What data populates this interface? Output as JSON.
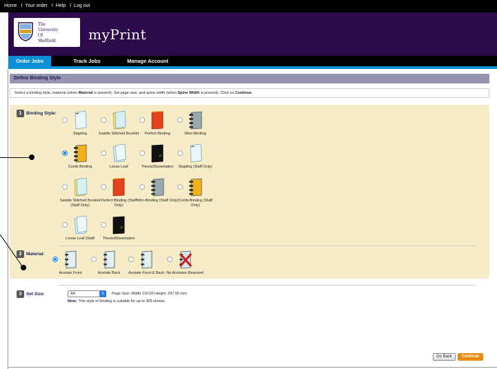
{
  "topbar": {
    "links": [
      "Home",
      "Your order",
      "Help",
      "Log out"
    ],
    "separator": "I"
  },
  "header": {
    "university": [
      "The",
      "University",
      "Of",
      "Sheffield."
    ],
    "app_title": "myPrint"
  },
  "nav": {
    "tabs": [
      "Order Jobs",
      "Track Jobs",
      "Manage Account"
    ],
    "active": "Order Jobs"
  },
  "page": {
    "section_title": "Define Binding Style",
    "instruction_parts": [
      "Select a binding style, material (when ",
      "Material",
      " is present), Set page size, and spine width (when ",
      "Spine Width",
      " is present). Click on ",
      "Continue",
      "."
    ]
  },
  "steps": {
    "binding": {
      "num": "1",
      "label": "Binding Style:"
    },
    "material": {
      "num": "2",
      "label": "Material:"
    },
    "size": {
      "num": "3",
      "label": "Set Size:"
    }
  },
  "binding_options": [
    {
      "label": "Stapling",
      "icon": "stapling-icon",
      "selected": false
    },
    {
      "label": "Saddle Stitched Booklet",
      "icon": "booklet-icon",
      "selected": false
    },
    {
      "label": "Perfect Binding",
      "icon": "perfect-binding-icon",
      "selected": false
    },
    {
      "label": "Wiro-Binding",
      "icon": "wiro-binding-icon",
      "selected": false
    },
    {
      "label": "Comb-Binding",
      "icon": "comb-binding-icon",
      "selected": true
    },
    {
      "label": "Loose Leaf",
      "icon": "loose-leaf-icon",
      "selected": false
    },
    {
      "label": "Thesis/Dissertation",
      "icon": "thesis-icon",
      "selected": false
    },
    {
      "label": "Stapling (Staff Only)",
      "icon": "stapling-icon",
      "selected": false
    },
    {
      "label": "Saddle Stitched Booklet (Staff Only)",
      "icon": "booklet-icon",
      "selected": false
    },
    {
      "label": "Perfect Binding (Staff Only)",
      "icon": "perfect-binding-icon",
      "selected": false
    },
    {
      "label": "Wiro-Binding (Staff Only)",
      "icon": "wiro-binding-icon",
      "selected": false
    },
    {
      "label": "Comb-Binding (Staff Only)",
      "icon": "comb-binding-icon",
      "selected": false
    },
    {
      "label": "Loose Leaf (Staff",
      "icon": "loose-leaf-icon",
      "selected": false
    },
    {
      "label": "Thesis/Dissertation",
      "icon": "thesis-icon",
      "selected": false
    }
  ],
  "material_options": [
    {
      "label": "Acetate Front",
      "icon": "acetate-front-icon",
      "selected": true
    },
    {
      "label": "Acetate Back",
      "icon": "acetate-back-icon",
      "selected": false
    },
    {
      "label": "Acetate Front & Back",
      "icon": "acetate-both-icon",
      "selected": false
    },
    {
      "label": "No Acetates Required",
      "icon": "no-acetate-icon",
      "selected": false
    }
  ],
  "size": {
    "value": "A4",
    "page_size_text": "Page Size: Width 210.00 Height: 297.00 mm",
    "note_label": "Note:",
    "note_text": "This style of binding is suitable for up to 425 sheets."
  },
  "buttons": {
    "back": "Go Back",
    "continue": "Continue"
  },
  "colors": {
    "header_bg": "#2d0a4a",
    "nav_active": "#0a8fd6",
    "panel_bg": "#f7ecc8",
    "continue_bg": "#e88a10",
    "section_head": "#9496b0"
  }
}
